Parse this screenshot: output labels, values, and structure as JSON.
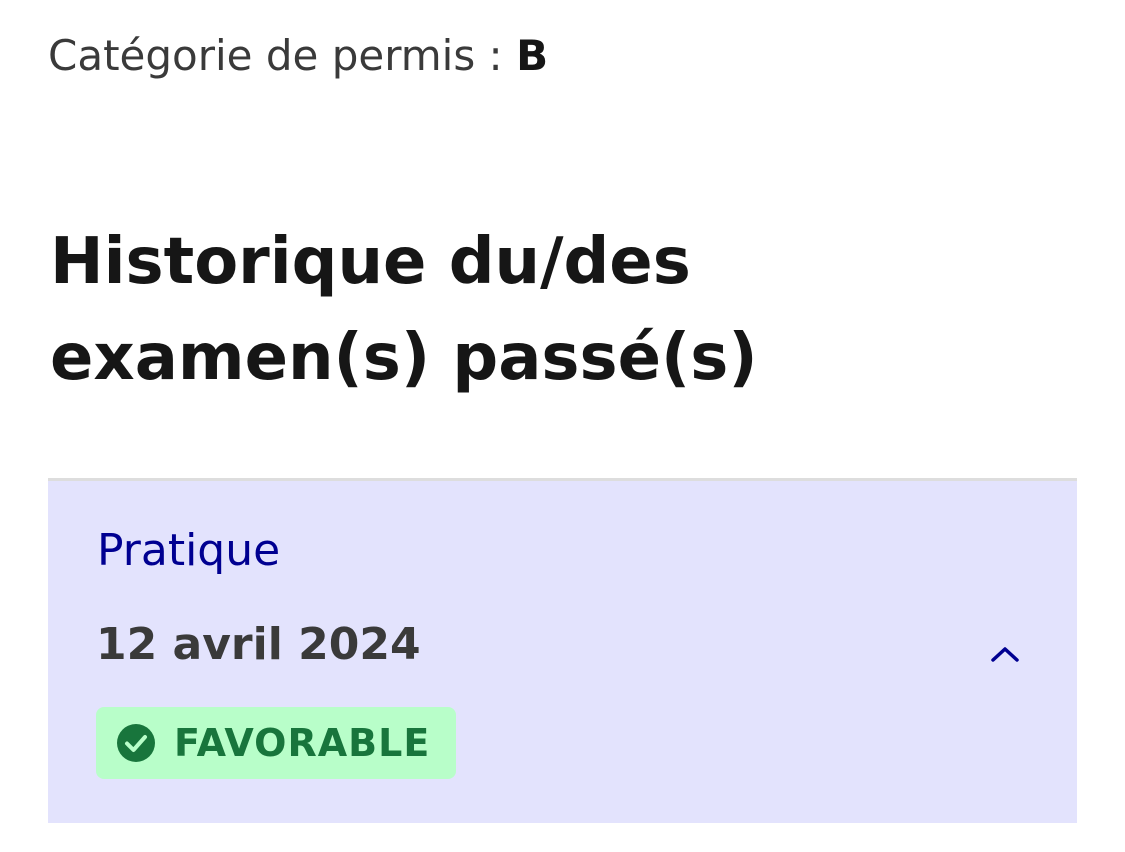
{
  "license": {
    "label": "Catégorie de permis :",
    "value": "B"
  },
  "page_title": "Historique du/des examen(s) passé(s)",
  "exams": [
    {
      "type": "Pratique",
      "date": "12 avril 2024",
      "result": "FAVORABLE",
      "expanded": true
    }
  ],
  "icons": {
    "toggle": "chevron-up-icon",
    "result": "check-circle-icon"
  },
  "colors": {
    "accent_blue": "#000091",
    "card_background": "#e3e3fd",
    "success_background": "#b8fec9",
    "success_text": "#18753c"
  }
}
